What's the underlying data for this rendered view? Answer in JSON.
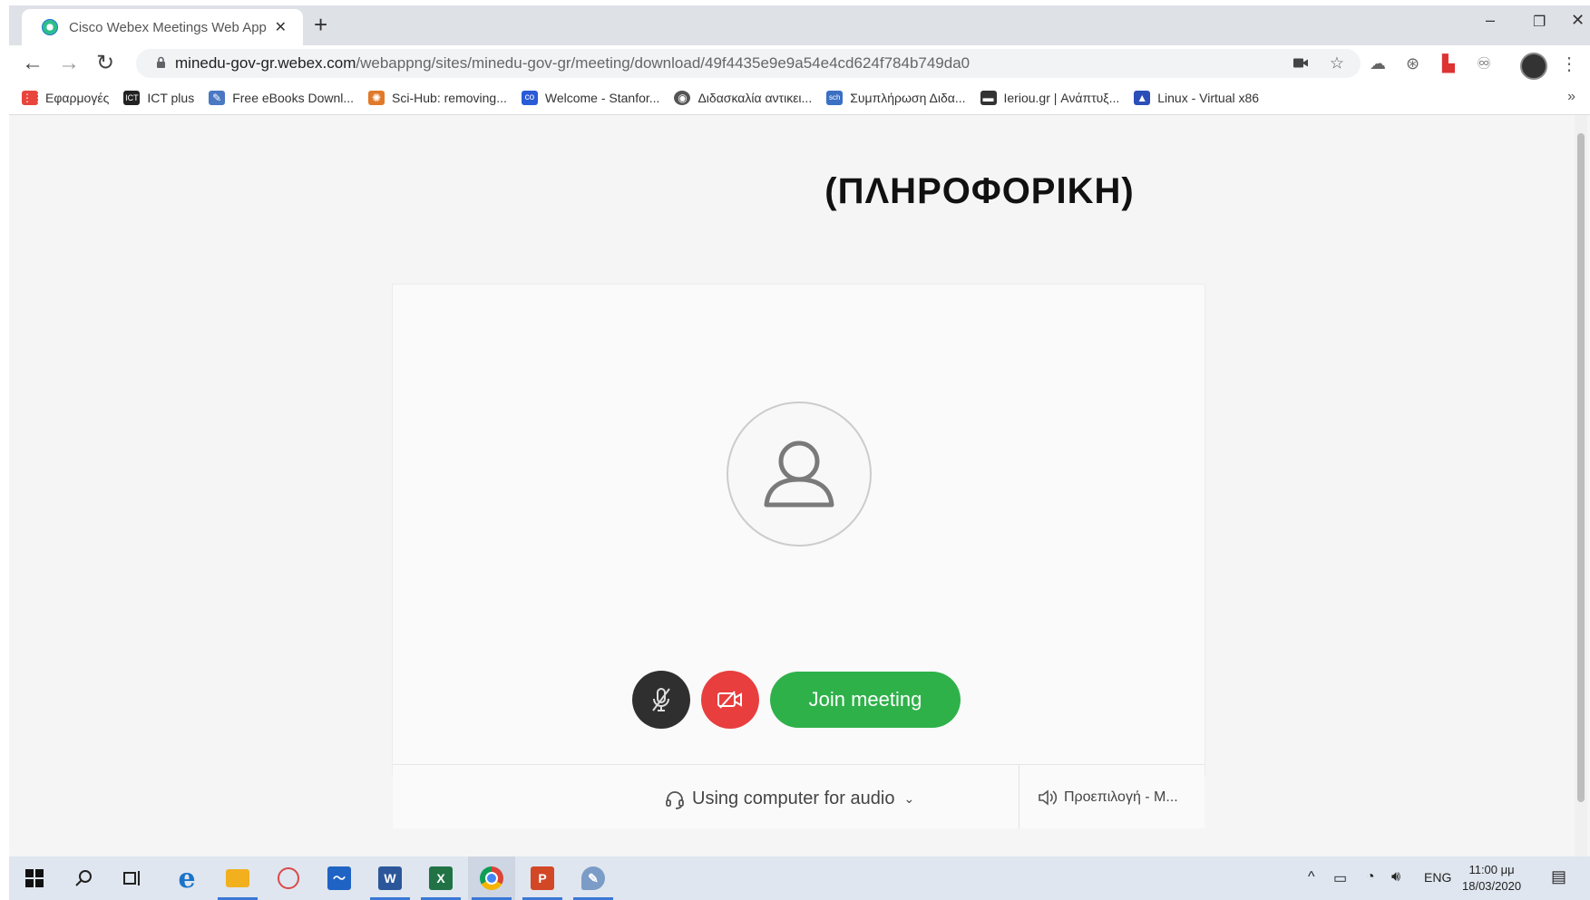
{
  "browser": {
    "tab_title": "Cisco Webex Meetings Web App",
    "tab_close": "✕",
    "new_tab": "+",
    "window_controls": {
      "minimize": "–",
      "restore": "❐",
      "close": "✕"
    },
    "url_host": "minedu-gov-gr.webex.com",
    "url_path": "/webappng/sites/minedu-gov-gr/meeting/download/49f4435e9e9a54e4cd624f784b749da0",
    "nav": {
      "back": "←",
      "forward": "→",
      "reload": "↻"
    }
  },
  "bookmarks": [
    {
      "label": "Εφαρμογές",
      "icon": "apps-grid-icon",
      "color": "#e8453c",
      "glyph": "⋮⋮"
    },
    {
      "label": "ICT plus",
      "icon": "ict-icon",
      "color": "#222222",
      "glyph": "ICT"
    },
    {
      "label": "Free eBooks Downl...",
      "icon": "ebooks-icon",
      "color": "#4a78c2",
      "glyph": "✎"
    },
    {
      "label": "Sci-Hub: removing...",
      "icon": "scihub-icon",
      "color": "#e07a2a",
      "glyph": "✺"
    },
    {
      "label": "Welcome - Stanfor...",
      "icon": "coursera-icon",
      "color": "#2a5bd7",
      "glyph": "co"
    },
    {
      "label": "Διδασκαλία αντικει...",
      "icon": "globe-icon",
      "color": "#555555",
      "glyph": "◉"
    },
    {
      "label": "Συμπλήρωση Διδα...",
      "icon": "sch-icon",
      "color": "#3a6fc4",
      "glyph": "sch"
    },
    {
      "label": "Ieriou.gr | Ανάπτυξ...",
      "icon": "ieriou-icon",
      "color": "#333333",
      "glyph": "▬"
    },
    {
      "label": "Linux - Virtual x86",
      "icon": "linux-icon",
      "color": "#2b4fb8",
      "glyph": "▲"
    }
  ],
  "bookmarks_more": "»",
  "meeting": {
    "title": "(ΠΛΗΡΟΦΟΡΙΚΗ)",
    "join_label": "Join meeting",
    "audio_label": "Using computer for audio",
    "speaker_label": "Προεπιλογή - M...",
    "colors": {
      "join": "#2fb14a",
      "video_off": "#e83e3e",
      "mute": "#2f2f2f"
    }
  },
  "taskbar": {
    "apps": [
      {
        "name": "start-icon"
      },
      {
        "name": "search-icon"
      },
      {
        "name": "task-view-icon"
      },
      {
        "name": "edge-icon",
        "glyph": "e",
        "color": "#1a73c9"
      },
      {
        "name": "file-explorer-icon",
        "color": "#f2b01e"
      },
      {
        "name": "snipping-icon",
        "color": "#d94a4a"
      },
      {
        "name": "whiteboard-icon",
        "color": "#1f63c4"
      },
      {
        "name": "word-icon",
        "glyph": "W",
        "color": "#2b579a"
      },
      {
        "name": "excel-icon",
        "glyph": "X",
        "color": "#217346"
      },
      {
        "name": "chrome-icon",
        "color": "#db4437"
      },
      {
        "name": "powerpoint-icon",
        "glyph": "P",
        "color": "#d24726"
      },
      {
        "name": "paint-icon",
        "color": "#7a9cc6"
      }
    ],
    "language": "ENG",
    "time": "11:00 μμ",
    "date": "18/03/2020"
  }
}
